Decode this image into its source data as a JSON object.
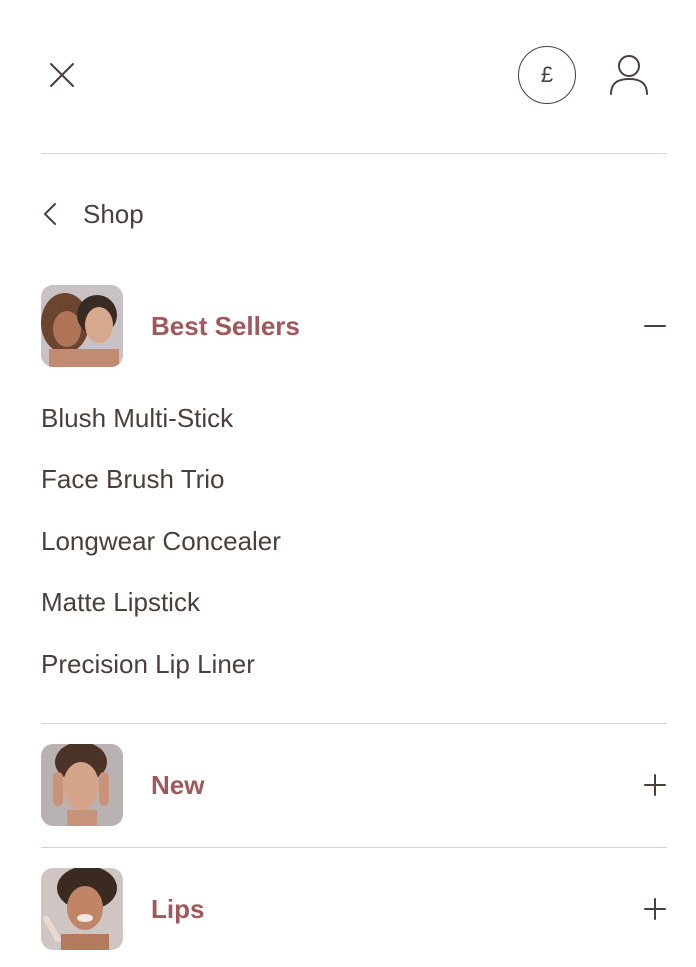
{
  "header": {
    "close_icon": "close-icon",
    "currency_symbol": "£",
    "account_icon": "user-icon"
  },
  "nav": {
    "back_label": "Shop",
    "back_icon": "chevron-left-icon"
  },
  "categories": [
    {
      "label": "Best Sellers",
      "expanded": true,
      "toggle_icon": "minus-icon",
      "items": [
        "Blush Multi-Stick",
        "Face Brush Trio",
        "Longwear Concealer",
        "Matte Lipstick",
        "Precision Lip Liner"
      ]
    },
    {
      "label": "New",
      "expanded": false,
      "toggle_icon": "plus-icon"
    },
    {
      "label": "Lips",
      "expanded": false,
      "toggle_icon": "plus-icon"
    }
  ],
  "colors": {
    "accent": "#a2585a",
    "text": "#4a3f3b",
    "divider": "#d8d4d3",
    "divider_active": "#e6c7cc"
  }
}
